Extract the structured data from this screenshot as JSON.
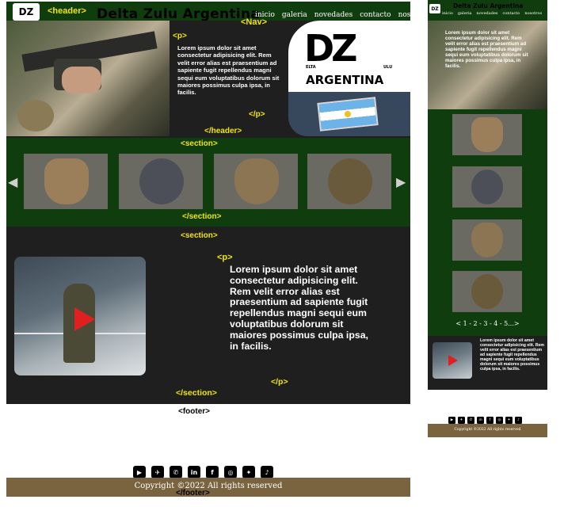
{
  "header": {
    "tag_open": "<header>",
    "brand": "Delta Zulu Argentina",
    "nav_tag": "<Nav>",
    "nav_items": [
      "inicio",
      "galeria",
      "novedades",
      "contacto",
      "nosotros"
    ],
    "p_open": "<p>",
    "p_close": "</p>",
    "text": "Lorem ipsum dolor sit amet consectetur adipisicing elit. Rem velit error alias est praesentium ad sapiente fugit repellendus magni sequi eum voluptatibus dolorum sit maiores possimus culpa ipsa, in facilis.",
    "tag_close": "</header>",
    "logo_mark": "DZ",
    "logo_text": "ARGENTINA",
    "logo_left": "ELTA",
    "logo_right": "ULU"
  },
  "gallery": {
    "tag_open": "<section>",
    "tag_close": "</section>",
    "prev": "◀",
    "next": "▶",
    "pagination": "< 1 - 2 - 3 - 4 - 5...>"
  },
  "video_section": {
    "tag_open": "<section>",
    "p_open": "<p>",
    "p_close": "</p>",
    "text": "Lorem ipsum dolor sit amet consectetur adipisicing elit. Rem velit error alias est praesentium ad sapiente fugit repellendus magni sequi eum voluptatibus dolorum sit maiores possimus culpa ipsa, in facilis.",
    "tag_close": "</section>"
  },
  "footer": {
    "tag_open": "<footer>",
    "tag_close": "</footer>",
    "copyright": "Copyright ©2022 All rights reserved",
    "social_icons": [
      "youtube-icon",
      "telegram-icon",
      "whatsapp-icon",
      "linkedin-icon",
      "facebook-icon",
      "instagram-icon",
      "twitter-icon",
      "tiktok-icon"
    ],
    "social_glyphs": [
      "▶",
      "✈",
      "✆",
      "in",
      "f",
      "◎",
      "✦",
      "♪"
    ]
  },
  "colors": {
    "header_green": "#0f3d0d",
    "tag_yellow": "#f2e600",
    "dark": "#1f1f1f",
    "footer_brown": "#7a6440",
    "play_red": "#e02020"
  }
}
